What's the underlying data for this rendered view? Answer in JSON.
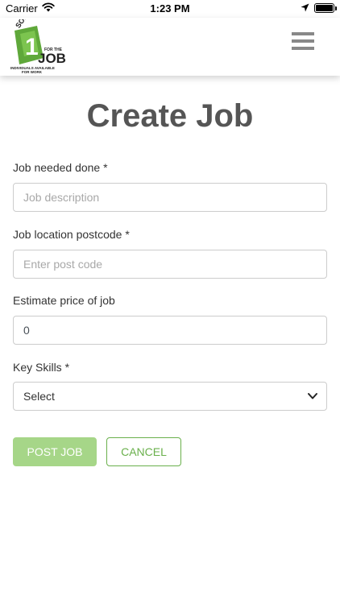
{
  "status_bar": {
    "carrier": "Carrier",
    "time": "1:23 PM"
  },
  "header": {
    "logo": {
      "text_some": "SOME",
      "text_number": "1",
      "text_for_the": "FOR THE",
      "text_job": "JOB",
      "tagline_1": "INDIVIDUALS AVAILABLE",
      "tagline_2": "FOR WORK"
    },
    "menu_icon": "hamburger-menu-icon"
  },
  "page": {
    "title": "Create Job"
  },
  "form": {
    "job_description": {
      "label": "Job needed done *",
      "placeholder": "Job description",
      "value": ""
    },
    "postcode": {
      "label": "Job location postcode *",
      "placeholder": "Enter post code",
      "value": ""
    },
    "price": {
      "label": "Estimate price of job",
      "value": "0"
    },
    "key_skills": {
      "label": "Key Skills *",
      "selected": "Select"
    }
  },
  "actions": {
    "post_label": "POST JOB",
    "cancel_label": "CANCEL"
  },
  "colors": {
    "brand_green": "#6ab04c",
    "post_button_bg": "#a6d688",
    "title_gray": "#555555"
  }
}
